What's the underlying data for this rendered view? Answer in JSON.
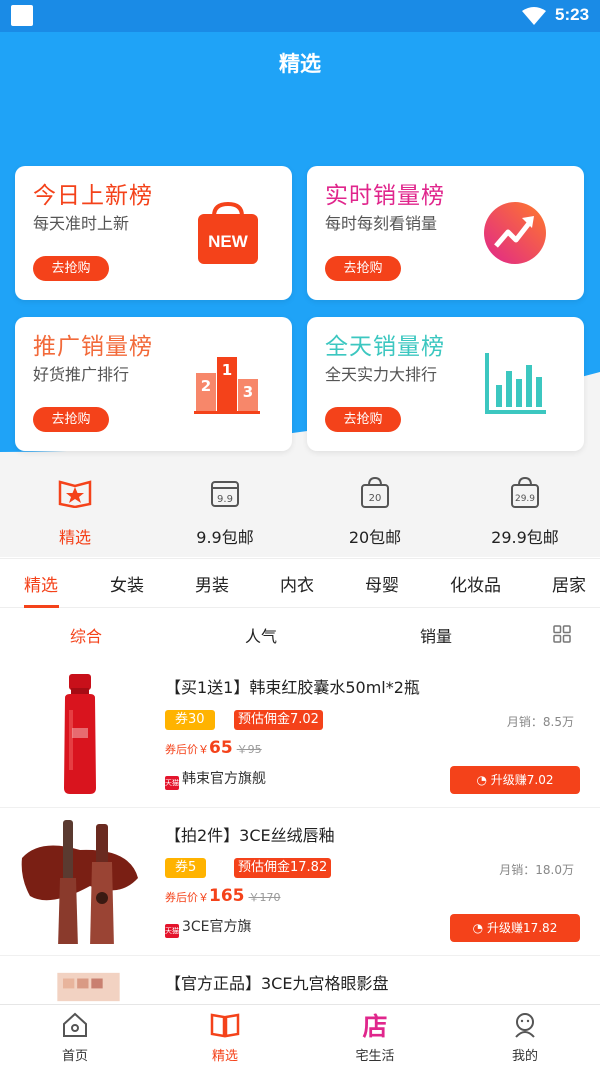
{
  "status_bar": {
    "time": "5:23"
  },
  "header": {
    "title": "精选"
  },
  "rank_cards": [
    {
      "title": "今日上新榜",
      "subtitle": "每天准时上新",
      "button": "去抢购",
      "title_color": "#f4421a",
      "icon": "new-bag-icon",
      "icon_text": "NEW"
    },
    {
      "title": "实时销量榜",
      "subtitle": "每时每刻看销量",
      "button": "去抢购",
      "title_color": "#e0268c",
      "icon": "trend-up-icon"
    },
    {
      "title": "推广销量榜",
      "subtitle": "好货推广排行",
      "button": "去抢购",
      "title_color": "#f26a3a",
      "icon": "podium-icon",
      "podium": [
        "2",
        "1",
        "3"
      ]
    },
    {
      "title": "全天销量榜",
      "subtitle": "全天实力大排行",
      "button": "去抢购",
      "title_color": "#3cc7c0",
      "icon": "bar-chart-icon"
    }
  ],
  "categories": [
    {
      "label": "精选",
      "icon": "star-book-icon",
      "active": true
    },
    {
      "label": "9.9包邮",
      "icon": "calendar-9-9-icon",
      "icon_text": "9.9"
    },
    {
      "label": "20包邮",
      "icon": "bag-20-icon",
      "icon_text": "20"
    },
    {
      "label": "29.9包邮",
      "icon": "bag-29-9-icon",
      "icon_text": "29.9"
    }
  ],
  "tabs": [
    "精选",
    "女装",
    "男装",
    "内衣",
    "母婴",
    "化妆品",
    "居家"
  ],
  "sort": [
    "综合",
    "人气",
    "销量"
  ],
  "products": [
    {
      "title": "【买1送1】韩束红胶囊水50ml*2瓶",
      "coupon": "券30",
      "commission": "预估佣金7.02",
      "sales": "月销：8.5万",
      "price_label": "券后价￥",
      "price": "65",
      "old_price": "￥95",
      "shop": "韩束官方旗舰",
      "shop_badge": "天猫",
      "button": "升级赚7.02"
    },
    {
      "title": "【拍2件】3CE丝绒唇釉",
      "coupon": "券5",
      "commission": "预估佣金17.82",
      "sales": "月销：18.0万",
      "price_label": "券后价￥",
      "price": "165",
      "old_price": "￥170",
      "shop": "3CE官方旗",
      "shop_badge": "天猫",
      "button": "升级赚17.82"
    },
    {
      "title": "【官方正品】3CE九宫格眼影盘"
    }
  ],
  "bottom_nav": [
    {
      "label": "首页",
      "icon": "home-icon"
    },
    {
      "label": "精选",
      "icon": "book-icon",
      "active": true
    },
    {
      "label": "宅生活",
      "icon": "shop-icon",
      "icon_text": "店"
    },
    {
      "label": "我的",
      "icon": "user-icon"
    }
  ],
  "colors": {
    "accent": "#f4421a",
    "header_blue": "#1fa3f7",
    "coupon_yellow": "#ffb300"
  }
}
